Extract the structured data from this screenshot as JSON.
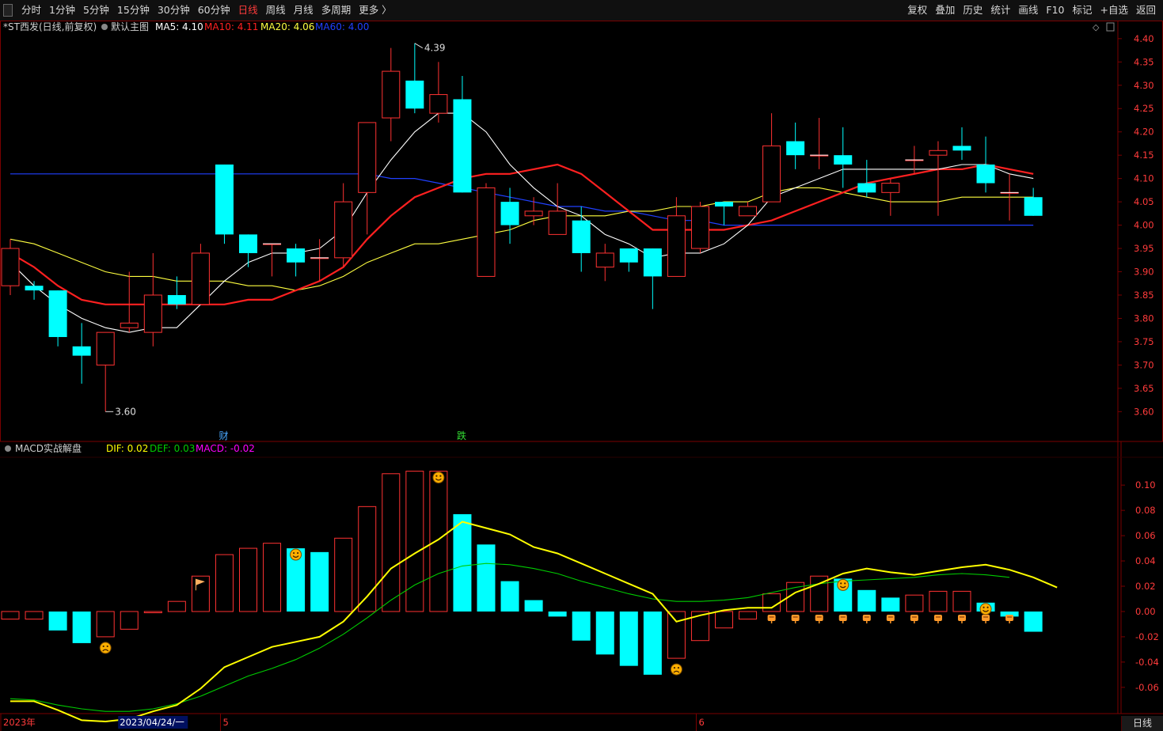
{
  "toolbar": {
    "left": [
      "分时",
      "1分钟",
      "5分钟",
      "15分钟",
      "30分钟",
      "60分钟",
      "日线",
      "周线",
      "月线",
      "多周期",
      "更多 〉"
    ],
    "active": "日线",
    "right": [
      "复权",
      "叠加",
      "历史",
      "统计",
      "画线",
      "F10",
      "标记",
      "+自选",
      "返回"
    ]
  },
  "bottom_tab": "日线",
  "colors": {
    "up": "#ff3232",
    "down": "#00ffff",
    "ma5": "#ffffff",
    "ma10": "#ff2020",
    "ma20": "#ffff40",
    "ma60": "#2040ff",
    "dif": "#ffff00",
    "dea": "#00cc00",
    "macd": "#ff00ff",
    "grid": "#7a0000",
    "axis_text": "#ff3b3b"
  },
  "chart_data": [
    {
      "type": "candlestick",
      "title": "*ST西发(日线,前复权)",
      "template_label": "默认主图",
      "legend": [
        {
          "label": "MA5: 4.10",
          "color": "#ffffff"
        },
        {
          "label": "MA10: 4.11",
          "color": "#ff2020"
        },
        {
          "label": "MA20: 4.06",
          "color": "#ffff40"
        },
        {
          "label": "MA60: 4.00",
          "color": "#2040ff"
        }
      ],
      "ylim": [
        3.57,
        4.415
      ],
      "yticks": [
        "4.40",
        "4.35",
        "4.30",
        "4.25",
        "4.20",
        "4.15",
        "4.10",
        "4.05",
        "4.00",
        "3.95",
        "3.90",
        "3.85",
        "3.80",
        "3.75",
        "3.70",
        "3.65",
        "3.60"
      ],
      "candles": [
        {
          "o": 3.87,
          "h": 3.97,
          "l": 3.85,
          "c": 3.95
        },
        {
          "o": 3.87,
          "h": 3.88,
          "l": 3.84,
          "c": 3.86
        },
        {
          "o": 3.86,
          "h": 3.86,
          "l": 3.74,
          "c": 3.76
        },
        {
          "o": 3.74,
          "h": 3.79,
          "l": 3.66,
          "c": 3.72
        },
        {
          "o": 3.7,
          "h": 3.77,
          "l": 3.6,
          "c": 3.77
        },
        {
          "o": 3.78,
          "h": 3.9,
          "l": 3.77,
          "c": 3.79
        },
        {
          "o": 3.77,
          "h": 3.94,
          "l": 3.74,
          "c": 3.85
        },
        {
          "o": 3.85,
          "h": 3.89,
          "l": 3.82,
          "c": 3.83
        },
        {
          "o": 3.83,
          "h": 3.96,
          "l": 3.83,
          "c": 3.94
        },
        {
          "o": 4.13,
          "h": 4.13,
          "l": 3.96,
          "c": 3.98
        },
        {
          "o": 3.98,
          "h": 3.98,
          "l": 3.91,
          "c": 3.94
        },
        {
          "o": 3.96,
          "h": 3.96,
          "l": 3.89,
          "c": 3.96
        },
        {
          "o": 3.95,
          "h": 3.96,
          "l": 3.89,
          "c": 3.92
        },
        {
          "o": 3.93,
          "h": 3.97,
          "l": 3.88,
          "c": 3.93
        },
        {
          "o": 3.93,
          "h": 4.09,
          "l": 3.91,
          "c": 4.05
        },
        {
          "o": 4.07,
          "h": 4.22,
          "l": 3.98,
          "c": 4.22
        },
        {
          "o": 4.23,
          "h": 4.38,
          "l": 4.18,
          "c": 4.33
        },
        {
          "o": 4.31,
          "h": 4.39,
          "l": 4.24,
          "c": 4.25
        },
        {
          "o": 4.24,
          "h": 4.35,
          "l": 4.22,
          "c": 4.28
        },
        {
          "o": 4.27,
          "h": 4.32,
          "l": 4.07,
          "c": 4.07
        },
        {
          "o": 3.89,
          "h": 4.09,
          "l": 3.89,
          "c": 4.08
        },
        {
          "o": 4.05,
          "h": 4.08,
          "l": 3.96,
          "c": 4.0
        },
        {
          "o": 4.02,
          "h": 4.06,
          "l": 4.0,
          "c": 4.03
        },
        {
          "o": 3.98,
          "h": 4.09,
          "l": 3.98,
          "c": 4.03
        },
        {
          "o": 4.01,
          "h": 4.04,
          "l": 3.9,
          "c": 3.94
        },
        {
          "o": 3.91,
          "h": 3.96,
          "l": 3.88,
          "c": 3.94
        },
        {
          "o": 3.95,
          "h": 3.95,
          "l": 3.9,
          "c": 3.92
        },
        {
          "o": 3.95,
          "h": 3.95,
          "l": 3.82,
          "c": 3.89
        },
        {
          "o": 3.89,
          "h": 4.06,
          "l": 3.89,
          "c": 4.02
        },
        {
          "o": 3.95,
          "h": 4.05,
          "l": 3.94,
          "c": 4.04
        },
        {
          "o": 4.05,
          "h": 4.05,
          "l": 4.0,
          "c": 4.04
        },
        {
          "o": 4.02,
          "h": 4.05,
          "l": 4.02,
          "c": 4.04
        },
        {
          "o": 4.05,
          "h": 4.24,
          "l": 4.05,
          "c": 4.17
        },
        {
          "o": 4.18,
          "h": 4.22,
          "l": 4.12,
          "c": 4.15
        },
        {
          "o": 4.15,
          "h": 4.23,
          "l": 4.12,
          "c": 4.15
        },
        {
          "o": 4.15,
          "h": 4.21,
          "l": 4.08,
          "c": 4.13
        },
        {
          "o": 4.09,
          "h": 4.14,
          "l": 4.06,
          "c": 4.07
        },
        {
          "o": 4.07,
          "h": 4.1,
          "l": 4.02,
          "c": 4.09
        },
        {
          "o": 4.14,
          "h": 4.17,
          "l": 4.11,
          "c": 4.14
        },
        {
          "o": 4.15,
          "h": 4.18,
          "l": 4.02,
          "c": 4.16
        },
        {
          "o": 4.17,
          "h": 4.21,
          "l": 4.14,
          "c": 4.16
        },
        {
          "o": 4.13,
          "h": 4.19,
          "l": 4.07,
          "c": 4.09
        },
        {
          "o": 4.07,
          "h": 4.11,
          "l": 4.01,
          "c": 4.07
        },
        {
          "o": 4.06,
          "h": 4.08,
          "l": 4.02,
          "c": 4.02
        }
      ],
      "ma5": [
        3.92,
        3.87,
        3.83,
        3.8,
        3.78,
        3.77,
        3.78,
        3.78,
        3.83,
        3.88,
        3.92,
        3.94,
        3.94,
        3.95,
        3.99,
        4.07,
        4.14,
        4.2,
        4.24,
        4.24,
        4.2,
        4.13,
        4.08,
        4.04,
        4.02,
        3.98,
        3.96,
        3.93,
        3.94,
        3.94,
        3.96,
        4.0,
        4.06,
        4.08,
        4.1,
        4.12,
        4.12,
        4.12,
        4.12,
        4.12,
        4.13,
        4.13,
        4.11,
        4.1
      ],
      "ma10": [
        3.94,
        3.91,
        3.87,
        3.84,
        3.83,
        3.83,
        3.83,
        3.83,
        3.83,
        3.83,
        3.84,
        3.84,
        3.86,
        3.88,
        3.91,
        3.97,
        4.02,
        4.06,
        4.08,
        4.1,
        4.11,
        4.11,
        4.12,
        4.13,
        4.11,
        4.07,
        4.03,
        3.99,
        3.99,
        3.99,
        3.99,
        4.0,
        4.01,
        4.03,
        4.05,
        4.07,
        4.09,
        4.1,
        4.11,
        4.12,
        4.12,
        4.13,
        4.12,
        4.11
      ],
      "ma20": [
        3.97,
        3.96,
        3.94,
        3.92,
        3.9,
        3.89,
        3.89,
        3.88,
        3.88,
        3.88,
        3.87,
        3.87,
        3.86,
        3.87,
        3.89,
        3.92,
        3.94,
        3.96,
        3.96,
        3.97,
        3.98,
        3.99,
        4.01,
        4.02,
        4.02,
        4.02,
        4.03,
        4.03,
        4.04,
        4.04,
        4.05,
        4.05,
        4.07,
        4.08,
        4.08,
        4.07,
        4.06,
        4.05,
        4.05,
        4.05,
        4.06,
        4.06,
        4.06,
        4.06
      ],
      "ma60": [
        4.11,
        4.11,
        4.11,
        4.11,
        4.11,
        4.11,
        4.11,
        4.11,
        4.11,
        4.11,
        4.11,
        4.11,
        4.11,
        4.11,
        4.11,
        4.11,
        4.1,
        4.1,
        4.09,
        4.08,
        4.07,
        4.06,
        4.05,
        4.04,
        4.04,
        4.03,
        4.03,
        4.02,
        4.01,
        4.01,
        4.0,
        4.0,
        4.0,
        4.0,
        4.0,
        4.0,
        4.0,
        4.0,
        4.0,
        4.0,
        4.0,
        4.0,
        4.0,
        4.0
      ],
      "annotations": [
        {
          "index": 17,
          "price": 4.39,
          "label": "4.39"
        },
        {
          "index": 4,
          "price": 3.6,
          "label": "3.60"
        }
      ],
      "event_markers": [
        {
          "index": 9,
          "label": "财",
          "color": "#4aa8ff"
        },
        {
          "index": 19,
          "label": "跌",
          "color": "#33dd33"
        }
      ]
    },
    {
      "type": "bar",
      "title": "MACD实战解盘",
      "legend": [
        {
          "label": "DIF: 0.02",
          "color": "#ffff00"
        },
        {
          "label": "DEF: 0.03",
          "color": "#00cc00"
        },
        {
          "label": "MACD: -0.02",
          "color": "#ff00ff"
        }
      ],
      "ylim": [
        -0.077,
        0.117
      ],
      "yticks": [
        "0.10",
        "0.08",
        "0.06",
        "0.04",
        "0.02",
        "0.00",
        "-0.02",
        "-0.04",
        "-0.06"
      ],
      "macd": [
        -0.006,
        -0.006,
        -0.015,
        -0.025,
        -0.02,
        -0.014,
        -0.001,
        0.008,
        0.028,
        0.045,
        0.05,
        0.054,
        0.05,
        0.047,
        0.058,
        0.083,
        0.109,
        0.111,
        0.111,
        0.077,
        0.053,
        0.024,
        0.009,
        -0.004,
        -0.023,
        -0.034,
        -0.043,
        -0.05,
        -0.037,
        -0.023,
        -0.013,
        -0.006,
        0.014,
        0.023,
        0.028,
        0.026,
        0.017,
        0.011,
        0.013,
        0.016,
        0.016,
        0.007,
        -0.004,
        -0.016
      ],
      "dif": [
        -0.071,
        -0.071,
        -0.078,
        -0.086,
        -0.087,
        -0.085,
        -0.079,
        -0.074,
        -0.061,
        -0.044,
        -0.036,
        -0.028,
        -0.024,
        -0.02,
        -0.008,
        0.012,
        0.034,
        0.046,
        0.057,
        0.071,
        0.066,
        0.061,
        0.051,
        0.046,
        0.038,
        0.03,
        0.022,
        0.014,
        -0.008,
        -0.003,
        0.001,
        0.003,
        0.003,
        0.015,
        0.022,
        0.03,
        0.034,
        0.031,
        0.029,
        0.032,
        0.035,
        0.037,
        0.033,
        0.027,
        0.019
      ],
      "dea": [
        -0.069,
        -0.07,
        -0.074,
        -0.077,
        -0.079,
        -0.079,
        -0.077,
        -0.073,
        -0.067,
        -0.059,
        -0.051,
        -0.045,
        -0.038,
        -0.029,
        -0.018,
        -0.005,
        0.009,
        0.021,
        0.03,
        0.036,
        0.038,
        0.037,
        0.034,
        0.03,
        0.024,
        0.019,
        0.014,
        0.01,
        0.008,
        0.008,
        0.009,
        0.011,
        0.015,
        0.019,
        0.022,
        0.024,
        0.025,
        0.026,
        0.027,
        0.029,
        0.03,
        0.029,
        0.027
      ],
      "signals": [
        {
          "index": 4,
          "type": "sad"
        },
        {
          "index": 8,
          "type": "flag"
        },
        {
          "index": 12,
          "type": "smile"
        },
        {
          "index": 18,
          "type": "smile"
        },
        {
          "index": 28,
          "type": "sad"
        },
        {
          "index": 35,
          "type": "smile"
        },
        {
          "index": 41,
          "type": "smile"
        }
      ],
      "buy_marks_from": 32,
      "buy_marks_to": 42
    }
  ],
  "x_axis": {
    "labels": [
      {
        "index": 0,
        "text": "2023年"
      },
      {
        "index": 5,
        "text": "2023/04/24/一",
        "highlight": true
      },
      {
        "index": 9,
        "text": "5"
      },
      {
        "index": 29,
        "text": "6"
      }
    ]
  }
}
